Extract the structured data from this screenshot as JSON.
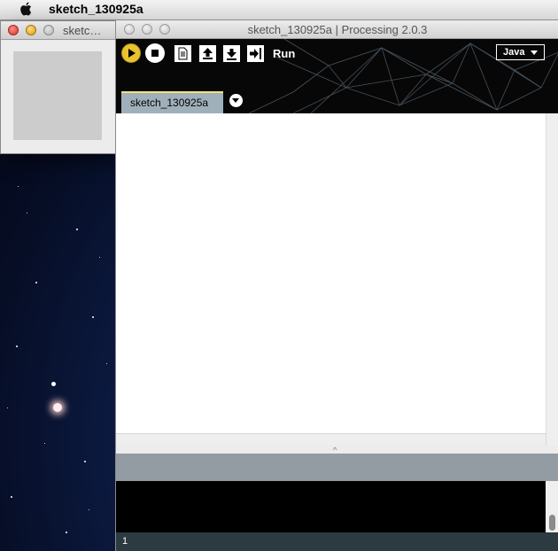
{
  "menubar": {
    "apple_icon": "apple-logo",
    "app_title": "sketch_130925a"
  },
  "sketch_window": {
    "title": "sketc…"
  },
  "main_window": {
    "title": "sketch_130925a | Processing 2.0.3",
    "toolbar": {
      "run_label": "Run",
      "mode": "Java",
      "buttons": [
        "run-icon",
        "stop-icon",
        "new-file-icon",
        "open-icon",
        "save-icon",
        "export-icon"
      ]
    },
    "tabs": [
      {
        "label": "sketch_130925a",
        "active": true
      }
    ],
    "footer": {
      "line_number": "1"
    }
  },
  "colors": {
    "run_button": "#e9c230",
    "tab_active": "#9fb0bb",
    "toolbar_bg": "#070707",
    "status_bar": "#929ca2",
    "console_bg": "#000000",
    "footer_bg": "#2c3a42"
  }
}
